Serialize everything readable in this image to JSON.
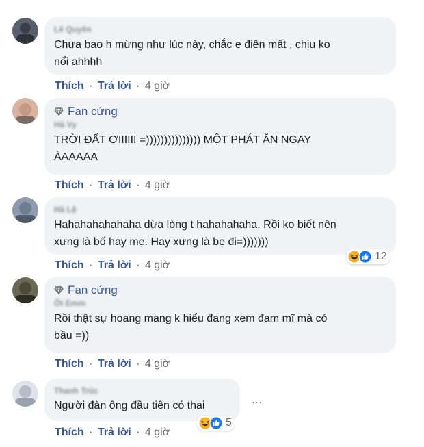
{
  "actions": {
    "like_label": "Thích",
    "reply_label": "Trả lời",
    "separator": "·"
  },
  "badges": {
    "fan": "Fan cứng"
  },
  "comments": [
    {
      "author": "Lê Quyên",
      "badge": null,
      "text": "Chưa bao h mừng như lúc này, chắc e điên mất , chịu ko\nnổi ahhhh",
      "time": "4 giờ",
      "reaction_count": null
    },
    {
      "author": "Hà Vy",
      "badge": "Fan cứng",
      "text": "TRỜI ĐẤT ƠIIIIII =))))))))))))))) MỘT PHÁT ĂN NGAY\nÀAAAAA",
      "time": "4 giờ",
      "reaction_count": null
    },
    {
      "author": "Hà Lệ",
      "badge": null,
      "text": "Hahahahahahaha dừa lòng t hahahahaha. Rồi ko biết nên\nxưng là bố hay mẹ. Hay xưng là bẹ đi=)))))))",
      "time": "4 giờ",
      "reaction_count": "12"
    },
    {
      "author": "Ốt Emm",
      "badge": "Fan cứng",
      "text": "Rồi thật sự hoang mang k hiểu đang xem đam mĩ mà có\nbầu =))",
      "time": "4 giờ",
      "reaction_count": null
    },
    {
      "author": "Thanh Trúc",
      "badge": null,
      "text": "Người đàn ông đầu tiên có thai",
      "time": "4 giờ",
      "reaction_count": "5"
    }
  ],
  "more_icon": "…",
  "colors": {
    "bubble": "#f0f2f5",
    "link": "#385898",
    "meta": "#65676b",
    "like_blue": "#1877f2",
    "haha_yellow": "#f7b125"
  }
}
